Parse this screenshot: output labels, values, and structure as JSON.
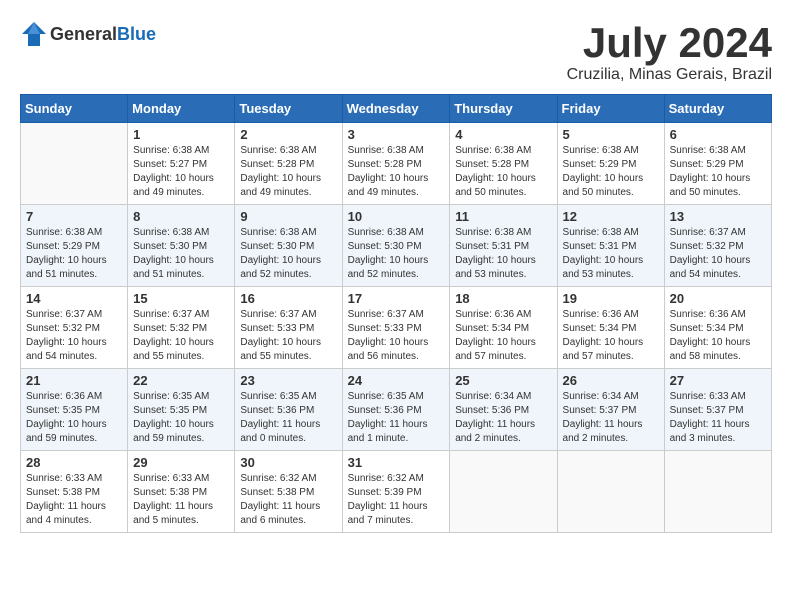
{
  "logo": {
    "general": "General",
    "blue": "Blue"
  },
  "title": {
    "month": "July 2024",
    "location": "Cruzilia, Minas Gerais, Brazil"
  },
  "headers": [
    "Sunday",
    "Monday",
    "Tuesday",
    "Wednesday",
    "Thursday",
    "Friday",
    "Saturday"
  ],
  "weeks": [
    [
      {
        "day": "",
        "info": ""
      },
      {
        "day": "1",
        "info": "Sunrise: 6:38 AM\nSunset: 5:27 PM\nDaylight: 10 hours\nand 49 minutes."
      },
      {
        "day": "2",
        "info": "Sunrise: 6:38 AM\nSunset: 5:28 PM\nDaylight: 10 hours\nand 49 minutes."
      },
      {
        "day": "3",
        "info": "Sunrise: 6:38 AM\nSunset: 5:28 PM\nDaylight: 10 hours\nand 49 minutes."
      },
      {
        "day": "4",
        "info": "Sunrise: 6:38 AM\nSunset: 5:28 PM\nDaylight: 10 hours\nand 50 minutes."
      },
      {
        "day": "5",
        "info": "Sunrise: 6:38 AM\nSunset: 5:29 PM\nDaylight: 10 hours\nand 50 minutes."
      },
      {
        "day": "6",
        "info": "Sunrise: 6:38 AM\nSunset: 5:29 PM\nDaylight: 10 hours\nand 50 minutes."
      }
    ],
    [
      {
        "day": "7",
        "info": "Sunrise: 6:38 AM\nSunset: 5:29 PM\nDaylight: 10 hours\nand 51 minutes."
      },
      {
        "day": "8",
        "info": "Sunrise: 6:38 AM\nSunset: 5:30 PM\nDaylight: 10 hours\nand 51 minutes."
      },
      {
        "day": "9",
        "info": "Sunrise: 6:38 AM\nSunset: 5:30 PM\nDaylight: 10 hours\nand 52 minutes."
      },
      {
        "day": "10",
        "info": "Sunrise: 6:38 AM\nSunset: 5:30 PM\nDaylight: 10 hours\nand 52 minutes."
      },
      {
        "day": "11",
        "info": "Sunrise: 6:38 AM\nSunset: 5:31 PM\nDaylight: 10 hours\nand 53 minutes."
      },
      {
        "day": "12",
        "info": "Sunrise: 6:38 AM\nSunset: 5:31 PM\nDaylight: 10 hours\nand 53 minutes."
      },
      {
        "day": "13",
        "info": "Sunrise: 6:37 AM\nSunset: 5:32 PM\nDaylight: 10 hours\nand 54 minutes."
      }
    ],
    [
      {
        "day": "14",
        "info": "Sunrise: 6:37 AM\nSunset: 5:32 PM\nDaylight: 10 hours\nand 54 minutes."
      },
      {
        "day": "15",
        "info": "Sunrise: 6:37 AM\nSunset: 5:32 PM\nDaylight: 10 hours\nand 55 minutes."
      },
      {
        "day": "16",
        "info": "Sunrise: 6:37 AM\nSunset: 5:33 PM\nDaylight: 10 hours\nand 55 minutes."
      },
      {
        "day": "17",
        "info": "Sunrise: 6:37 AM\nSunset: 5:33 PM\nDaylight: 10 hours\nand 56 minutes."
      },
      {
        "day": "18",
        "info": "Sunrise: 6:36 AM\nSunset: 5:34 PM\nDaylight: 10 hours\nand 57 minutes."
      },
      {
        "day": "19",
        "info": "Sunrise: 6:36 AM\nSunset: 5:34 PM\nDaylight: 10 hours\nand 57 minutes."
      },
      {
        "day": "20",
        "info": "Sunrise: 6:36 AM\nSunset: 5:34 PM\nDaylight: 10 hours\nand 58 minutes."
      }
    ],
    [
      {
        "day": "21",
        "info": "Sunrise: 6:36 AM\nSunset: 5:35 PM\nDaylight: 10 hours\nand 59 minutes."
      },
      {
        "day": "22",
        "info": "Sunrise: 6:35 AM\nSunset: 5:35 PM\nDaylight: 10 hours\nand 59 minutes."
      },
      {
        "day": "23",
        "info": "Sunrise: 6:35 AM\nSunset: 5:36 PM\nDaylight: 11 hours\nand 0 minutes."
      },
      {
        "day": "24",
        "info": "Sunrise: 6:35 AM\nSunset: 5:36 PM\nDaylight: 11 hours\nand 1 minute."
      },
      {
        "day": "25",
        "info": "Sunrise: 6:34 AM\nSunset: 5:36 PM\nDaylight: 11 hours\nand 2 minutes."
      },
      {
        "day": "26",
        "info": "Sunrise: 6:34 AM\nSunset: 5:37 PM\nDaylight: 11 hours\nand 2 minutes."
      },
      {
        "day": "27",
        "info": "Sunrise: 6:33 AM\nSunset: 5:37 PM\nDaylight: 11 hours\nand 3 minutes."
      }
    ],
    [
      {
        "day": "28",
        "info": "Sunrise: 6:33 AM\nSunset: 5:38 PM\nDaylight: 11 hours\nand 4 minutes."
      },
      {
        "day": "29",
        "info": "Sunrise: 6:33 AM\nSunset: 5:38 PM\nDaylight: 11 hours\nand 5 minutes."
      },
      {
        "day": "30",
        "info": "Sunrise: 6:32 AM\nSunset: 5:38 PM\nDaylight: 11 hours\nand 6 minutes."
      },
      {
        "day": "31",
        "info": "Sunrise: 6:32 AM\nSunset: 5:39 PM\nDaylight: 11 hours\nand 7 minutes."
      },
      {
        "day": "",
        "info": ""
      },
      {
        "day": "",
        "info": ""
      },
      {
        "day": "",
        "info": ""
      }
    ]
  ]
}
